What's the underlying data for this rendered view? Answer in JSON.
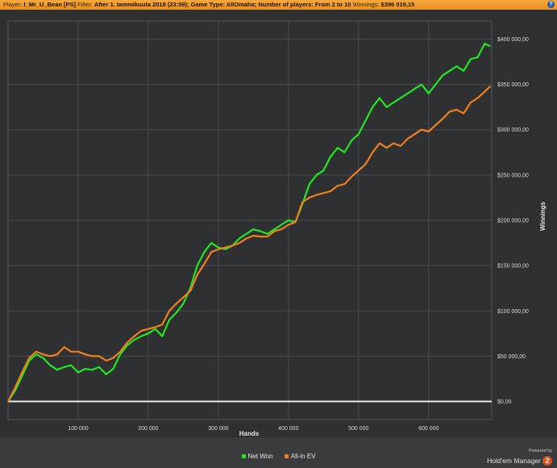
{
  "header": {
    "player_label": "Player:",
    "player_value": "I_Mr_U_Bean [PS]",
    "filter_label": "Filter:",
    "filter_value": "After 1. tammikuuta 2018 (23:59); Game Type: AllOmaha; Number of players: From 2 to 10",
    "winnings_label": "Winnings:",
    "winnings_value": "$396 019,15",
    "help_icon": "?"
  },
  "branding": {
    "powered_by": "Powered by",
    "product": "Hold'em Manager",
    "version_badge": "2"
  },
  "chart_data": {
    "type": "line",
    "xlabel": "Hands",
    "ylabel": "Winnings",
    "xlim": [
      0,
      690000
    ],
    "ylim": [
      -20000,
      420000
    ],
    "x_ticks": [
      100000,
      200000,
      300000,
      400000,
      500000,
      600000
    ],
    "x_tick_labels": [
      "100 000",
      "200 000",
      "300 000",
      "400 000",
      "500 000",
      "600 000"
    ],
    "y_ticks": [
      0,
      50000,
      100000,
      150000,
      200000,
      250000,
      300000,
      350000,
      400000
    ],
    "y_tick_labels": [
      "$0,00",
      "$50 000,00",
      "$100 000,00",
      "$150 000,00",
      "$200 000,00",
      "$250 000,00",
      "$300 000,00",
      "$350 000,00",
      "$400 000,00"
    ],
    "grid": true,
    "legend_position": "bottom-center",
    "series": [
      {
        "name": "Net Won",
        "color": "#22e622",
        "x": [
          0,
          10000,
          20000,
          30000,
          40000,
          50000,
          60000,
          70000,
          80000,
          90000,
          100000,
          110000,
          120000,
          130000,
          140000,
          150000,
          160000,
          170000,
          180000,
          190000,
          200000,
          210000,
          220000,
          230000,
          240000,
          250000,
          260000,
          270000,
          280000,
          290000,
          300000,
          310000,
          320000,
          330000,
          340000,
          350000,
          360000,
          370000,
          380000,
          390000,
          400000,
          410000,
          420000,
          430000,
          440000,
          450000,
          460000,
          470000,
          480000,
          490000,
          500000,
          510000,
          520000,
          530000,
          540000,
          550000,
          560000,
          570000,
          580000,
          590000,
          600000,
          610000,
          620000,
          630000,
          640000,
          650000,
          660000,
          670000,
          680000,
          688000
        ],
        "values": [
          0,
          12000,
          28000,
          45000,
          52000,
          48000,
          40000,
          35000,
          38000,
          40000,
          32000,
          36000,
          35000,
          38000,
          30000,
          36000,
          52000,
          62000,
          68000,
          72000,
          75000,
          80000,
          72000,
          90000,
          98000,
          108000,
          125000,
          150000,
          165000,
          175000,
          170000,
          168000,
          172000,
          180000,
          185000,
          190000,
          188000,
          185000,
          190000,
          195000,
          200000,
          198000,
          218000,
          240000,
          250000,
          255000,
          270000,
          280000,
          275000,
          288000,
          295000,
          310000,
          325000,
          335000,
          325000,
          330000,
          335000,
          340000,
          345000,
          350000,
          340000,
          350000,
          360000,
          365000,
          370000,
          365000,
          378000,
          380000,
          395000,
          392000
        ]
      },
      {
        "name": "All-in EV",
        "color": "#f07f1f",
        "x": [
          0,
          10000,
          20000,
          30000,
          40000,
          50000,
          60000,
          70000,
          80000,
          90000,
          100000,
          110000,
          120000,
          130000,
          140000,
          150000,
          160000,
          170000,
          180000,
          190000,
          200000,
          210000,
          220000,
          230000,
          240000,
          250000,
          260000,
          270000,
          280000,
          290000,
          300000,
          310000,
          320000,
          330000,
          340000,
          350000,
          360000,
          370000,
          380000,
          390000,
          400000,
          410000,
          420000,
          430000,
          440000,
          450000,
          460000,
          470000,
          480000,
          490000,
          500000,
          510000,
          520000,
          530000,
          540000,
          550000,
          560000,
          570000,
          580000,
          590000,
          600000,
          610000,
          620000,
          630000,
          640000,
          650000,
          660000,
          670000,
          680000,
          688000
        ],
        "values": [
          0,
          15000,
          32000,
          48000,
          55000,
          52000,
          50000,
          52000,
          60000,
          55000,
          55000,
          52000,
          50000,
          50000,
          45000,
          48000,
          55000,
          65000,
          72000,
          78000,
          80000,
          82000,
          85000,
          100000,
          108000,
          115000,
          122000,
          140000,
          152000,
          165000,
          168000,
          170000,
          172000,
          175000,
          180000,
          183000,
          182000,
          182000,
          188000,
          190000,
          195000,
          198000,
          220000,
          225000,
          228000,
          230000,
          232000,
          238000,
          240000,
          248000,
          255000,
          262000,
          275000,
          285000,
          280000,
          285000,
          282000,
          290000,
          295000,
          300000,
          298000,
          305000,
          312000,
          320000,
          322000,
          318000,
          330000,
          335000,
          342000,
          348000
        ]
      }
    ]
  }
}
